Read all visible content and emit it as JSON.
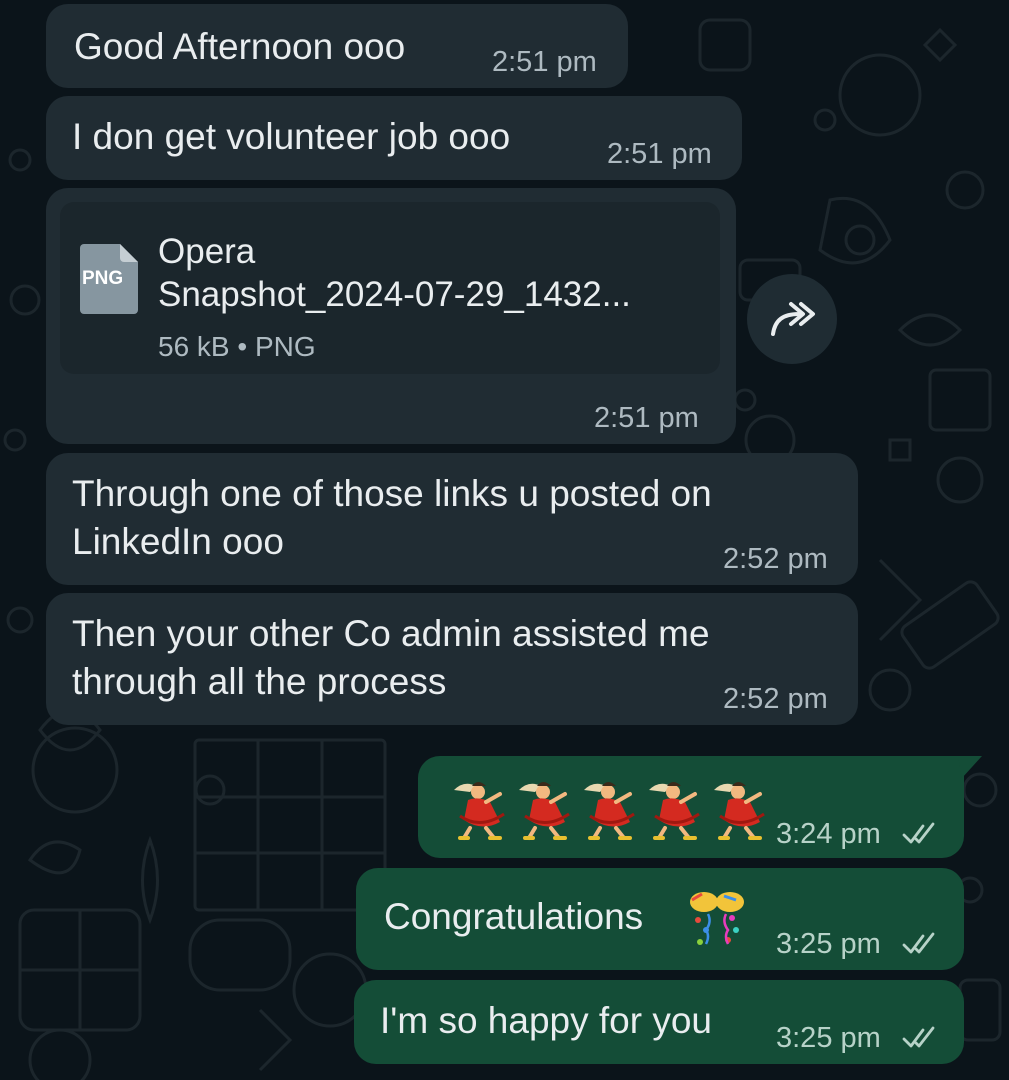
{
  "messages": [
    {
      "text": "Good Afternoon ooo",
      "time": "2:51 pm"
    },
    {
      "text": "I don get volunteer job ooo",
      "time": "2:51 pm"
    },
    {
      "doc_name_line1": "Opera",
      "doc_name_line2": "Snapshot_2024-07-29_1432...",
      "doc_meta": "56 kB • PNG",
      "doc_type": "PNG",
      "time": "2:51 pm"
    },
    {
      "text_line1": "Through one of those links u posted on",
      "text_line2": "LinkedIn ooo",
      "time": "2:52 pm"
    },
    {
      "text_line1": "Then your other Co admin assisted me",
      "text_line2": "through all the process",
      "time": "2:52 pm"
    },
    {
      "emoji_count": 5,
      "time": "3:24 pm"
    },
    {
      "text": "Congratulations",
      "time": "3:25 pm"
    },
    {
      "text": "I'm so happy for you",
      "time": "3:25 pm"
    }
  ],
  "icons": {
    "forward": "forward-icon",
    "read_receipt": "double-check-icon",
    "document": "png-file-icon",
    "dancer": "dancing-woman-emoji",
    "party": "party-popper-emoji"
  },
  "colors": {
    "background": "#0b141a",
    "incoming_bubble": "#202c33",
    "outgoing_bubble": "#144d37",
    "text": "#e9edef",
    "meta_text": "#aebac1"
  }
}
